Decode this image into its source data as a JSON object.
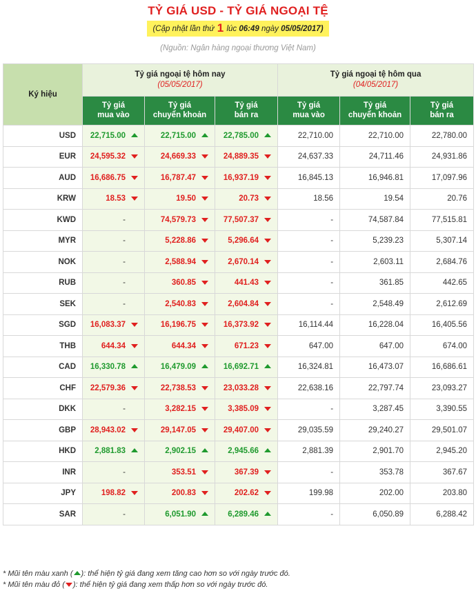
{
  "header": {
    "title": "TỶ GIÁ USD - TỶ GIÁ NGOẠI TỆ",
    "update_prefix": "(Cập nhật lần thứ",
    "update_count": "1",
    "update_at_label": "lúc",
    "update_time": "06:49",
    "update_day_label": "ngày",
    "update_date": "05/05/2017)",
    "source": "(Nguồn: Ngân hàng ngoại thương Việt Nam)"
  },
  "table": {
    "col_symbol": "Ký hiệu",
    "today_group": "Tỷ giá ngoại tệ hôm nay",
    "today_date": "(05/05/2017)",
    "prev_group": "Tỷ giá ngoại tệ hôm qua",
    "prev_date": "(04/05/2017)",
    "sub_headers": [
      [
        "Tỷ giá",
        "mua vào"
      ],
      [
        "Tỷ giá",
        "chuyển khoản"
      ],
      [
        "Tỷ giá",
        "bán ra"
      ],
      [
        "Tỷ giá",
        "mua vào"
      ],
      [
        "Tỷ giá",
        "chuyển khoản"
      ],
      [
        "Tỷ giá",
        "bán ra"
      ]
    ],
    "rows": [
      {
        "code": "USD",
        "buy": "22,715.00",
        "buy_t": "up",
        "transfer": "22,715.00",
        "transfer_t": "up",
        "sell": "22,785.00",
        "sell_t": "up",
        "p_buy": "22,710.00",
        "p_transfer": "22,710.00",
        "p_sell": "22,780.00"
      },
      {
        "code": "EUR",
        "buy": "24,595.32",
        "buy_t": "down",
        "transfer": "24,669.33",
        "transfer_t": "down",
        "sell": "24,889.35",
        "sell_t": "down",
        "p_buy": "24,637.33",
        "p_transfer": "24,711.46",
        "p_sell": "24,931.86"
      },
      {
        "code": "AUD",
        "buy": "16,686.75",
        "buy_t": "down",
        "transfer": "16,787.47",
        "transfer_t": "down",
        "sell": "16,937.19",
        "sell_t": "down",
        "p_buy": "16,845.13",
        "p_transfer": "16,946.81",
        "p_sell": "17,097.96"
      },
      {
        "code": "KRW",
        "buy": "18.53",
        "buy_t": "down",
        "transfer": "19.50",
        "transfer_t": "down",
        "sell": "20.73",
        "sell_t": "down",
        "p_buy": "18.56",
        "p_transfer": "19.54",
        "p_sell": "20.76"
      },
      {
        "code": "KWD",
        "buy": "-",
        "buy_t": "none",
        "transfer": "74,579.73",
        "transfer_t": "down",
        "sell": "77,507.37",
        "sell_t": "down",
        "p_buy": "-",
        "p_transfer": "74,587.84",
        "p_sell": "77,515.81"
      },
      {
        "code": "MYR",
        "buy": "-",
        "buy_t": "none",
        "transfer": "5,228.86",
        "transfer_t": "down",
        "sell": "5,296.64",
        "sell_t": "down",
        "p_buy": "-",
        "p_transfer": "5,239.23",
        "p_sell": "5,307.14"
      },
      {
        "code": "NOK",
        "buy": "-",
        "buy_t": "none",
        "transfer": "2,588.94",
        "transfer_t": "down",
        "sell": "2,670.14",
        "sell_t": "down",
        "p_buy": "-",
        "p_transfer": "2,603.11",
        "p_sell": "2,684.76"
      },
      {
        "code": "RUB",
        "buy": "-",
        "buy_t": "none",
        "transfer": "360.85",
        "transfer_t": "down",
        "sell": "441.43",
        "sell_t": "down",
        "p_buy": "-",
        "p_transfer": "361.85",
        "p_sell": "442.65"
      },
      {
        "code": "SEK",
        "buy": "-",
        "buy_t": "none",
        "transfer": "2,540.83",
        "transfer_t": "down",
        "sell": "2,604.84",
        "sell_t": "down",
        "p_buy": "-",
        "p_transfer": "2,548.49",
        "p_sell": "2,612.69"
      },
      {
        "code": "SGD",
        "buy": "16,083.37",
        "buy_t": "down",
        "transfer": "16,196.75",
        "transfer_t": "down",
        "sell": "16,373.92",
        "sell_t": "down",
        "p_buy": "16,114.44",
        "p_transfer": "16,228.04",
        "p_sell": "16,405.56"
      },
      {
        "code": "THB",
        "buy": "644.34",
        "buy_t": "down",
        "transfer": "644.34",
        "transfer_t": "down",
        "sell": "671.23",
        "sell_t": "down",
        "p_buy": "647.00",
        "p_transfer": "647.00",
        "p_sell": "674.00"
      },
      {
        "code": "CAD",
        "buy": "16,330.78",
        "buy_t": "up",
        "transfer": "16,479.09",
        "transfer_t": "up",
        "sell": "16,692.71",
        "sell_t": "up",
        "p_buy": "16,324.81",
        "p_transfer": "16,473.07",
        "p_sell": "16,686.61"
      },
      {
        "code": "CHF",
        "buy": "22,579.36",
        "buy_t": "down",
        "transfer": "22,738.53",
        "transfer_t": "down",
        "sell": "23,033.28",
        "sell_t": "down",
        "p_buy": "22,638.16",
        "p_transfer": "22,797.74",
        "p_sell": "23,093.27"
      },
      {
        "code": "DKK",
        "buy": "-",
        "buy_t": "none",
        "transfer": "3,282.15",
        "transfer_t": "down",
        "sell": "3,385.09",
        "sell_t": "down",
        "p_buy": "-",
        "p_transfer": "3,287.45",
        "p_sell": "3,390.55"
      },
      {
        "code": "GBP",
        "buy": "28,943.02",
        "buy_t": "down",
        "transfer": "29,147.05",
        "transfer_t": "down",
        "sell": "29,407.00",
        "sell_t": "down",
        "p_buy": "29,035.59",
        "p_transfer": "29,240.27",
        "p_sell": "29,501.07"
      },
      {
        "code": "HKD",
        "buy": "2,881.83",
        "buy_t": "up",
        "transfer": "2,902.15",
        "transfer_t": "up",
        "sell": "2,945.66",
        "sell_t": "up",
        "p_buy": "2,881.39",
        "p_transfer": "2,901.70",
        "p_sell": "2,945.20"
      },
      {
        "code": "INR",
        "buy": "-",
        "buy_t": "none",
        "transfer": "353.51",
        "transfer_t": "down",
        "sell": "367.39",
        "sell_t": "down",
        "p_buy": "-",
        "p_transfer": "353.78",
        "p_sell": "367.67"
      },
      {
        "code": "JPY",
        "buy": "198.82",
        "buy_t": "down",
        "transfer": "200.83",
        "transfer_t": "down",
        "sell": "202.62",
        "sell_t": "down",
        "p_buy": "199.98",
        "p_transfer": "202.00",
        "p_sell": "203.80"
      },
      {
        "code": "SAR",
        "buy": "-",
        "buy_t": "none",
        "transfer": "6,051.90",
        "transfer_t": "up",
        "sell": "6,289.46",
        "sell_t": "up",
        "p_buy": "-",
        "p_transfer": "6,050.89",
        "p_sell": "6,288.42"
      }
    ]
  },
  "notes": {
    "green_prefix": "* Mũi tên màu xanh (",
    "green_suffix": "): thể hiện tỷ giá đang xem tăng cao hơn so với ngày trước đó.",
    "red_prefix": "* Mũi tên màu đỏ (",
    "red_suffix": "): thể hiện tỷ giá đang xem thấp hơn so với ngày trước đó."
  },
  "colors": {
    "up": "#1f9a2e",
    "down": "#e0201f",
    "header_green": "#2b8a43",
    "title_red": "#e02020",
    "highlight_yellow": "#fff25c"
  }
}
